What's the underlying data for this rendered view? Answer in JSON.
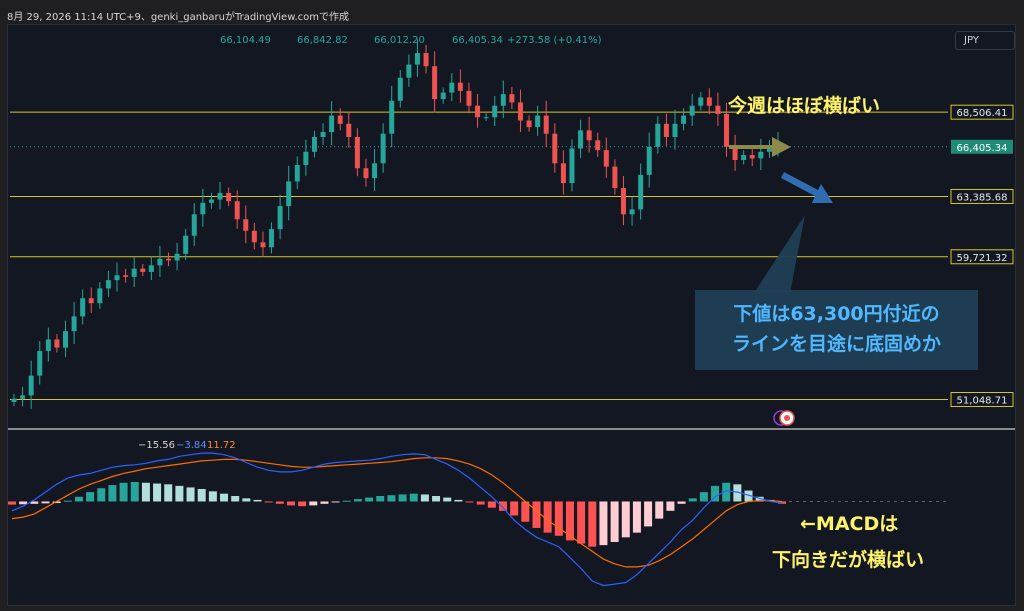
{
  "caption": "8月 29, 2026 11:14 UTC+9、genki_ganbaruがTradingView.comで作成",
  "currency_button": "JPY",
  "colors": {
    "up": "#26a69a",
    "down": "#ef5350",
    "level": "#d4c62c",
    "macd": "#2962ff",
    "signal": "#ff6d00",
    "annotation": "#fff36a",
    "callout_text": "#4fb8ff",
    "current_price_bg": "#1e8b76"
  },
  "chart_data": [
    {
      "type": "candlestick",
      "ohlc_display": {
        "open": "66,104.49",
        "high": "66,842.82",
        "low": "66,012.20",
        "close": "66,405.34",
        "change": "+273.58 (+0.41%)"
      },
      "price_levels": [
        {
          "label": "68,506.41",
          "value": 68506.41
        },
        {
          "label": "63,385.68",
          "value": 63385.68
        },
        {
          "label": "59,721.32",
          "value": 59721.32
        },
        {
          "label": "51,048.71",
          "value": 51048.71
        }
      ],
      "current_price": {
        "label": "66,405.34",
        "value": 66405.34
      },
      "ylim": [
        49500,
        73500
      ],
      "series_close": [
        51100,
        51300,
        52500,
        54000,
        54700,
        54200,
        55200,
        56100,
        57200,
        56900,
        57800,
        58300,
        58600,
        58500,
        59000,
        58800,
        59200,
        59600,
        59500,
        59900,
        61000,
        62300,
        63000,
        63200,
        63600,
        63100,
        62000,
        61300,
        60600,
        60300,
        61400,
        62800,
        64300,
        65300,
        66100,
        67000,
        67300,
        68300,
        67800,
        67000,
        65100,
        64500,
        65400,
        67200,
        69200,
        70600,
        71400,
        72100,
        71300,
        69300,
        69700,
        70300,
        69800,
        68900,
        68200,
        68200,
        68900,
        69600,
        69100,
        68000,
        67600,
        68300,
        67200,
        65400,
        64200,
        66300,
        67400,
        66800,
        66200,
        65200,
        63900,
        62300,
        62600,
        64700,
        66400,
        67800,
        67000,
        67800,
        68300,
        68900,
        69400,
        68900,
        68400,
        66400,
        65600,
        65900,
        65700,
        66100,
        66400,
        66650
      ]
    },
    {
      "type": "line",
      "values_display": {
        "histogram": "−15.56",
        "macd": "−3.84",
        "signal": "11.72"
      },
      "ylim": [
        -600,
        420
      ],
      "series": [
        {
          "name": "MACD",
          "values": [
            -60,
            -30,
            10,
            60,
            110,
            150,
            170,
            180,
            200,
            220,
            230,
            235,
            245,
            260,
            270,
            290,
            300,
            310,
            310,
            300,
            280,
            250,
            220,
            200,
            190,
            190,
            200,
            220,
            240,
            250,
            255,
            260,
            265,
            275,
            290,
            300,
            305,
            300,
            270,
            240,
            200,
            150,
            90,
            30,
            -40,
            -120,
            -180,
            -230,
            -260,
            -290,
            -360,
            -430,
            -510,
            -540,
            -530,
            -520,
            -470,
            -400,
            -330,
            -260,
            -180,
            -120,
            -40,
            30,
            70,
            60,
            40,
            20,
            0,
            -10
          ]
        },
        {
          "name": "Signal",
          "values": [
            -110,
            -100,
            -80,
            -40,
            0,
            40,
            80,
            110,
            135,
            160,
            180,
            195,
            210,
            220,
            230,
            240,
            250,
            260,
            265,
            270,
            270,
            265,
            255,
            245,
            235,
            225,
            220,
            220,
            225,
            230,
            235,
            240,
            245,
            250,
            255,
            265,
            275,
            280,
            280,
            275,
            260,
            240,
            210,
            170,
            120,
            60,
            0,
            -60,
            -120,
            -170,
            -220,
            -270,
            -320,
            -370,
            -400,
            -420,
            -420,
            -410,
            -380,
            -340,
            -290,
            -240,
            -180,
            -120,
            -60,
            -20,
            0,
            5,
            5,
            0
          ]
        },
        {
          "name": "Histogram",
          "values": [
            -20,
            -18,
            -15,
            -12,
            -10,
            5,
            30,
            60,
            85,
            105,
            120,
            125,
            120,
            115,
            110,
            100,
            90,
            80,
            65,
            50,
            35,
            20,
            10,
            -5,
            -15,
            -25,
            -30,
            -25,
            -15,
            -5,
            5,
            15,
            25,
            35,
            40,
            45,
            50,
            45,
            35,
            25,
            10,
            -5,
            -20,
            -40,
            -60,
            -90,
            -130,
            -170,
            -200,
            -220,
            -250,
            -270,
            -290,
            -280,
            -260,
            -230,
            -200,
            -160,
            -110,
            -60,
            -15,
            20,
            60,
            100,
            120,
            110,
            70,
            30,
            10,
            -15
          ]
        }
      ]
    }
  ],
  "annotations": {
    "weekly_flat": "今週はほぼ横ばい",
    "callout_line1": "下値は63,300円付近の",
    "callout_line2": "ラインを目途に底固めか",
    "macd_line1": "←MACDは",
    "macd_line2": "下向きだが横ばい"
  }
}
